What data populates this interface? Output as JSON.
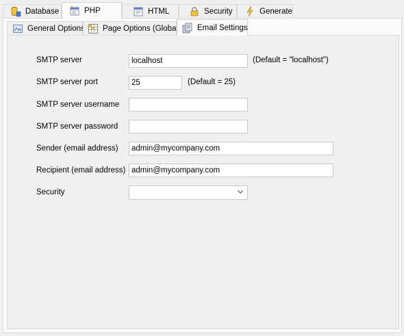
{
  "tabs_top": [
    {
      "label": "Database",
      "icon": "database-icon"
    },
    {
      "label": "PHP",
      "icon": "php-icon",
      "active": true
    },
    {
      "label": "HTML",
      "icon": "html-icon"
    },
    {
      "label": "Security",
      "icon": "lock-icon"
    },
    {
      "label": "Generate",
      "icon": "lightning-icon"
    }
  ],
  "tabs_sub": [
    {
      "label": "General Options",
      "icon": "general-options-icon"
    },
    {
      "label": "Page Options (Global)",
      "icon": "page-options-icon"
    },
    {
      "label": "Email Settings",
      "icon": "email-settings-icon",
      "active": true
    }
  ],
  "form": {
    "smtp_server": {
      "label": "SMTP server",
      "value": "localhost",
      "hint": "(Default = \"localhost\")"
    },
    "smtp_port": {
      "label": "SMTP server port",
      "value": "25",
      "hint": "(Default = 25)"
    },
    "smtp_username": {
      "label": "SMTP server username",
      "value": ""
    },
    "smtp_password": {
      "label": "SMTP server password",
      "value": ""
    },
    "sender": {
      "label": "Sender (email address)",
      "value": "admin@mycompany.com"
    },
    "recipient": {
      "label": "Recipient (email address)",
      "value": "admin@mycompany.com"
    },
    "security": {
      "label": "Security",
      "value": ""
    }
  },
  "colors": {
    "window_bg": "#f0f0f0",
    "active_tab_bg": "#fafafa",
    "border": "#d9d9d9"
  }
}
